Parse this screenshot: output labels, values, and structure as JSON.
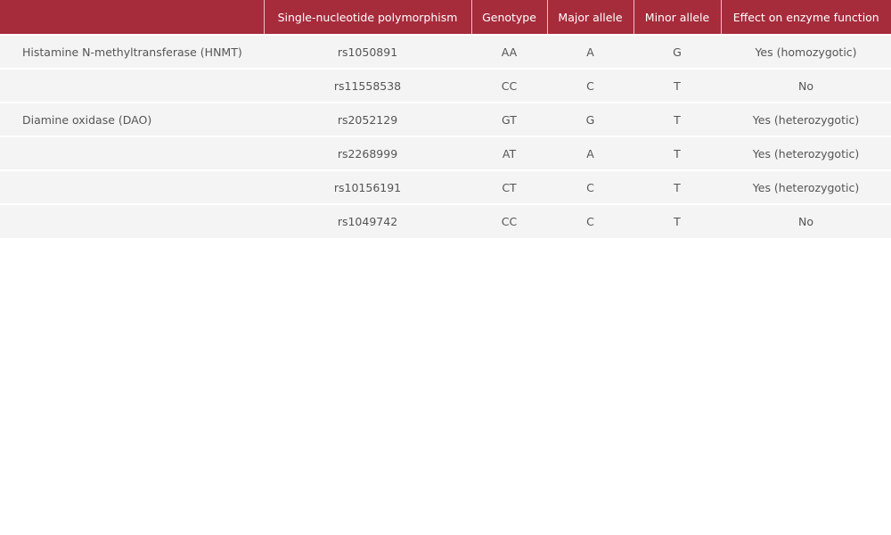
{
  "table": {
    "headers": [
      "",
      "Single-nucleotide polymorphism",
      "Genotype",
      "Major allele",
      "Minor allele",
      "Effect on enzyme function"
    ],
    "rows": [
      [
        "Histamine N-methyltransferase (HNMT)",
        "rs1050891",
        "AA",
        "A",
        "G",
        "Yes (homozygotic)"
      ],
      [
        "",
        "rs11558538",
        "CC",
        "C",
        "T",
        "No"
      ],
      [
        "Diamine oxidase (DAO)",
        "rs2052129",
        "GT",
        "G",
        "T",
        "Yes (heterozygotic)"
      ],
      [
        "",
        "rs2268999",
        "AT",
        "A",
        "T",
        "Yes (heterozygotic)"
      ],
      [
        "",
        "rs10156191",
        "CT",
        "C",
        "T",
        "Yes (heterozygotic)"
      ],
      [
        "",
        "rs1049742",
        "CC",
        "C",
        "T",
        "No"
      ]
    ]
  },
  "colors": {
    "header_bg": "#a62b3b",
    "header_text": "#ffffff",
    "row_bg": "#f4f4f4",
    "cell_text": "#555555"
  }
}
